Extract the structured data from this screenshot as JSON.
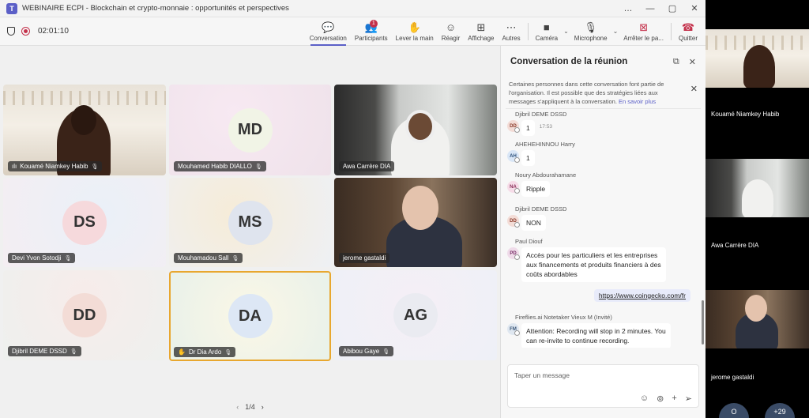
{
  "window": {
    "title": "WEBINAIRE ECPI - Blockchain et crypto-monnaie : opportunités et perspectives",
    "logo": "T",
    "controls": [
      "…",
      "—",
      "▢",
      "✕"
    ]
  },
  "toolbar": {
    "timer": "02:01:10",
    "items": [
      {
        "id": "conversation",
        "label": "Conversation",
        "icon": "chat-icon",
        "glyph": "💬",
        "active": true
      },
      {
        "id": "participants",
        "label": "Participants",
        "icon": "people-icon",
        "glyph": "👥",
        "badge": "1"
      },
      {
        "id": "raise-hand",
        "label": "Lever la main",
        "icon": "hand-icon",
        "glyph": "✋"
      },
      {
        "id": "react",
        "label": "Réagir",
        "icon": "emoji-icon",
        "glyph": "☺"
      },
      {
        "id": "view",
        "label": "Affichage",
        "icon": "grid-icon",
        "glyph": "⊞"
      },
      {
        "id": "more",
        "label": "Autres",
        "icon": "more-icon",
        "glyph": "⋯"
      }
    ],
    "camera_label": "Caméra",
    "camera_glyph": "■",
    "mic_label": "Microphone",
    "mic_glyph": "🎙",
    "share_label": "Arrêter le pa...",
    "share_glyph": "⊠",
    "quit_label": "Quitter",
    "quit_glyph": "☎"
  },
  "stage": {
    "pager": "1/4",
    "prev": "‹",
    "next": "›",
    "tiles": [
      {
        "name": "Kouamé Niamkey Habib",
        "type": "video-room",
        "signal": "ılı"
      },
      {
        "name": "Mouhamed Habib DIALLO",
        "initials": "MD",
        "type": "avatar",
        "bg": "g1",
        "avatar_color": "#f1f4e6"
      },
      {
        "name": "Awa Carrère DIA",
        "type": "video-window"
      },
      {
        "name": "Devi Yvon Sotodji",
        "initials": "DS",
        "type": "avatar",
        "bg": "g2",
        "avatar_color": "#f6d9dc"
      },
      {
        "name": "Mouhamadou Sall",
        "initials": "MS",
        "type": "avatar",
        "bg": "g3",
        "avatar_color": "#dfe4ee"
      },
      {
        "name": "jerome gastaldi",
        "type": "video-office"
      },
      {
        "name": "Djibril DEME DSSD",
        "initials": "DD",
        "type": "avatar",
        "bg": "g4",
        "avatar_color": "#f3dcd6"
      },
      {
        "name": "Dr Dia Ardo",
        "initials": "DA",
        "type": "avatar",
        "bg": "g5",
        "avatar_color": "#dde7f5",
        "hand": "✋"
      },
      {
        "name": "Abibou Gaye",
        "initials": "AG",
        "type": "avatar",
        "bg": "g6",
        "avatar_color": "#eaebf1"
      }
    ]
  },
  "chat": {
    "title": "Conversation de la réunion",
    "notice": "Certaines personnes dans cette conversation font partie de l'organisation. Il est possible que des stratégies liées aux messages s'appliquent à la conversation.",
    "notice_link": "En savoir plus",
    "messages": [
      {
        "sender": "Djibril DEME DSSD",
        "initials": "DD",
        "text": "1",
        "time": "17:53",
        "color": "#f3dcd6",
        "ink": "#8a3a2a"
      },
      {
        "sender": "AHEHEHINNOU Harry",
        "initials": "AH",
        "text": "1",
        "color": "#d9e6f6",
        "ink": "#2b4f7a"
      },
      {
        "sender": "Noury Abdourahamane",
        "initials": "NA",
        "text": "Ripple",
        "color": "#f6dce8",
        "ink": "#8a2f5a"
      },
      {
        "sender": "Djibril DEME DSSD",
        "initials": "DD",
        "text": "NON",
        "color": "#f3dcd6",
        "ink": "#8a3a2a"
      },
      {
        "sender": "Paul Diouf",
        "initials": "PD",
        "text_lines": [
          "Accès pour les particuliers et les entreprises",
          "aux financements et produits financiers à des",
          "coûts abordables"
        ],
        "color": "#efdbe9",
        "ink": "#7a2f68"
      },
      {
        "sender": "Fireflies.ai Notetaker Vieux M (Invité)",
        "initials": "FM",
        "text_lines": [
          "Attention: Recording will stop in 2 minutes. You",
          "can re-invite to continue recording."
        ],
        "color": "#dfe7f0",
        "ink": "#3a5678"
      }
    ],
    "my_message": "https://www.coingecko.com/fr",
    "compose_placeholder": "Taper un message"
  },
  "rail": {
    "tiles": [
      {
        "name": "Kouamé Niamkey Habib"
      },
      {
        "name": "Awa Carrère DIA"
      },
      {
        "name": "jerome gastaldi"
      }
    ],
    "more_initial": "O",
    "more_count": "+29"
  }
}
